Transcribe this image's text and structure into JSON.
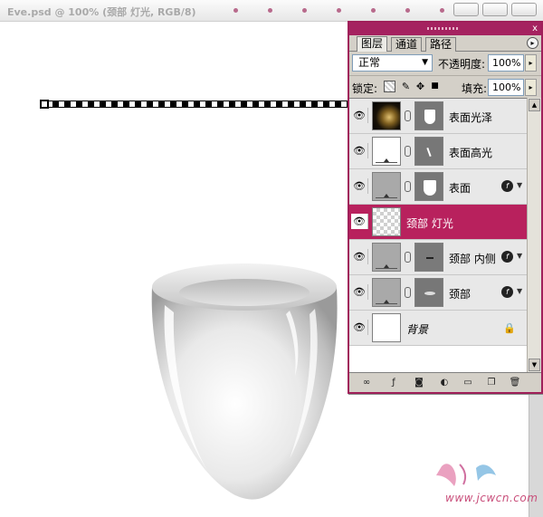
{
  "document": {
    "title": "Eve.psd @ 100% (颈部 灯光, RGB/8)"
  },
  "panel": {
    "tabs": [
      {
        "label": "图层",
        "active": true
      },
      {
        "label": "通道",
        "active": false
      },
      {
        "label": "路径",
        "active": false
      }
    ],
    "close_glyph": "x",
    "menu_glyph": "▸",
    "blend_mode": "正常",
    "opacity_label": "不透明度:",
    "opacity_value": "100%",
    "lock_label": "锁定:",
    "fill_label": "填充:",
    "fill_value": "100%",
    "layers": [
      {
        "name": "表面光泽",
        "thumb": "photo",
        "mask": "cup",
        "fx": false,
        "selected": false
      },
      {
        "name": "表面高光",
        "thumb": "white-adjust",
        "mask": "stroke",
        "fx": false,
        "selected": false
      },
      {
        "name": "表面",
        "thumb": "gray-adjust",
        "mask": "cup",
        "fx": true,
        "selected": false
      },
      {
        "name": "颈部 灯光",
        "thumb": "transparent",
        "mask": null,
        "fx": false,
        "selected": true
      },
      {
        "name": "颈部 内侧",
        "thumb": "gray-adjust",
        "mask": "line",
        "fx": true,
        "selected": false
      },
      {
        "name": "颈部",
        "thumb": "gray-adjust",
        "mask": "ellipse",
        "fx": true,
        "selected": false
      },
      {
        "name": "背景",
        "thumb": "white",
        "mask": null,
        "fx": false,
        "selected": false,
        "locked": true
      }
    ],
    "footer_icons": [
      "link-icon",
      "layer-style-icon",
      "add-mask-icon",
      "adjustment-layer-icon",
      "new-group-icon",
      "new-layer-icon",
      "delete-layer-icon"
    ]
  },
  "watermark": {
    "text": "www.jcwcn.com"
  },
  "colors": {
    "accent": "#b8215d",
    "panel_border": "#a0205a",
    "panel_bg": "#d4d0c8"
  }
}
